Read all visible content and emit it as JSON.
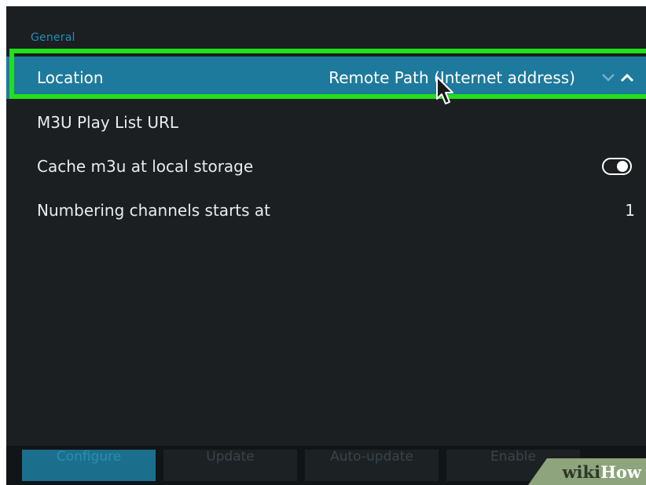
{
  "settings": {
    "section_label": "General",
    "rows": [
      {
        "label": "Location",
        "value": "Remote Path (Internet address)"
      },
      {
        "label": "M3U Play List URL",
        "value": ""
      },
      {
        "label": "Cache m3u at local storage",
        "toggle_on": true
      },
      {
        "label": "Numbering channels starts at",
        "value": "1"
      }
    ]
  },
  "bottom_bar": {
    "buttons": [
      "Configure",
      "Update",
      "Auto-update",
      "Enable"
    ]
  },
  "watermark": {
    "part1": "wiki",
    "part2": "How"
  },
  "colors": {
    "background": "#1b1f21",
    "selected_row": "#1e7a9c",
    "highlight_outline": "#22e01a",
    "section_label": "#1f8fb6"
  },
  "icons": {
    "spinner_down": "chevron-down-icon",
    "spinner_up": "chevron-up-icon",
    "cursor": "mouse-cursor-icon"
  }
}
